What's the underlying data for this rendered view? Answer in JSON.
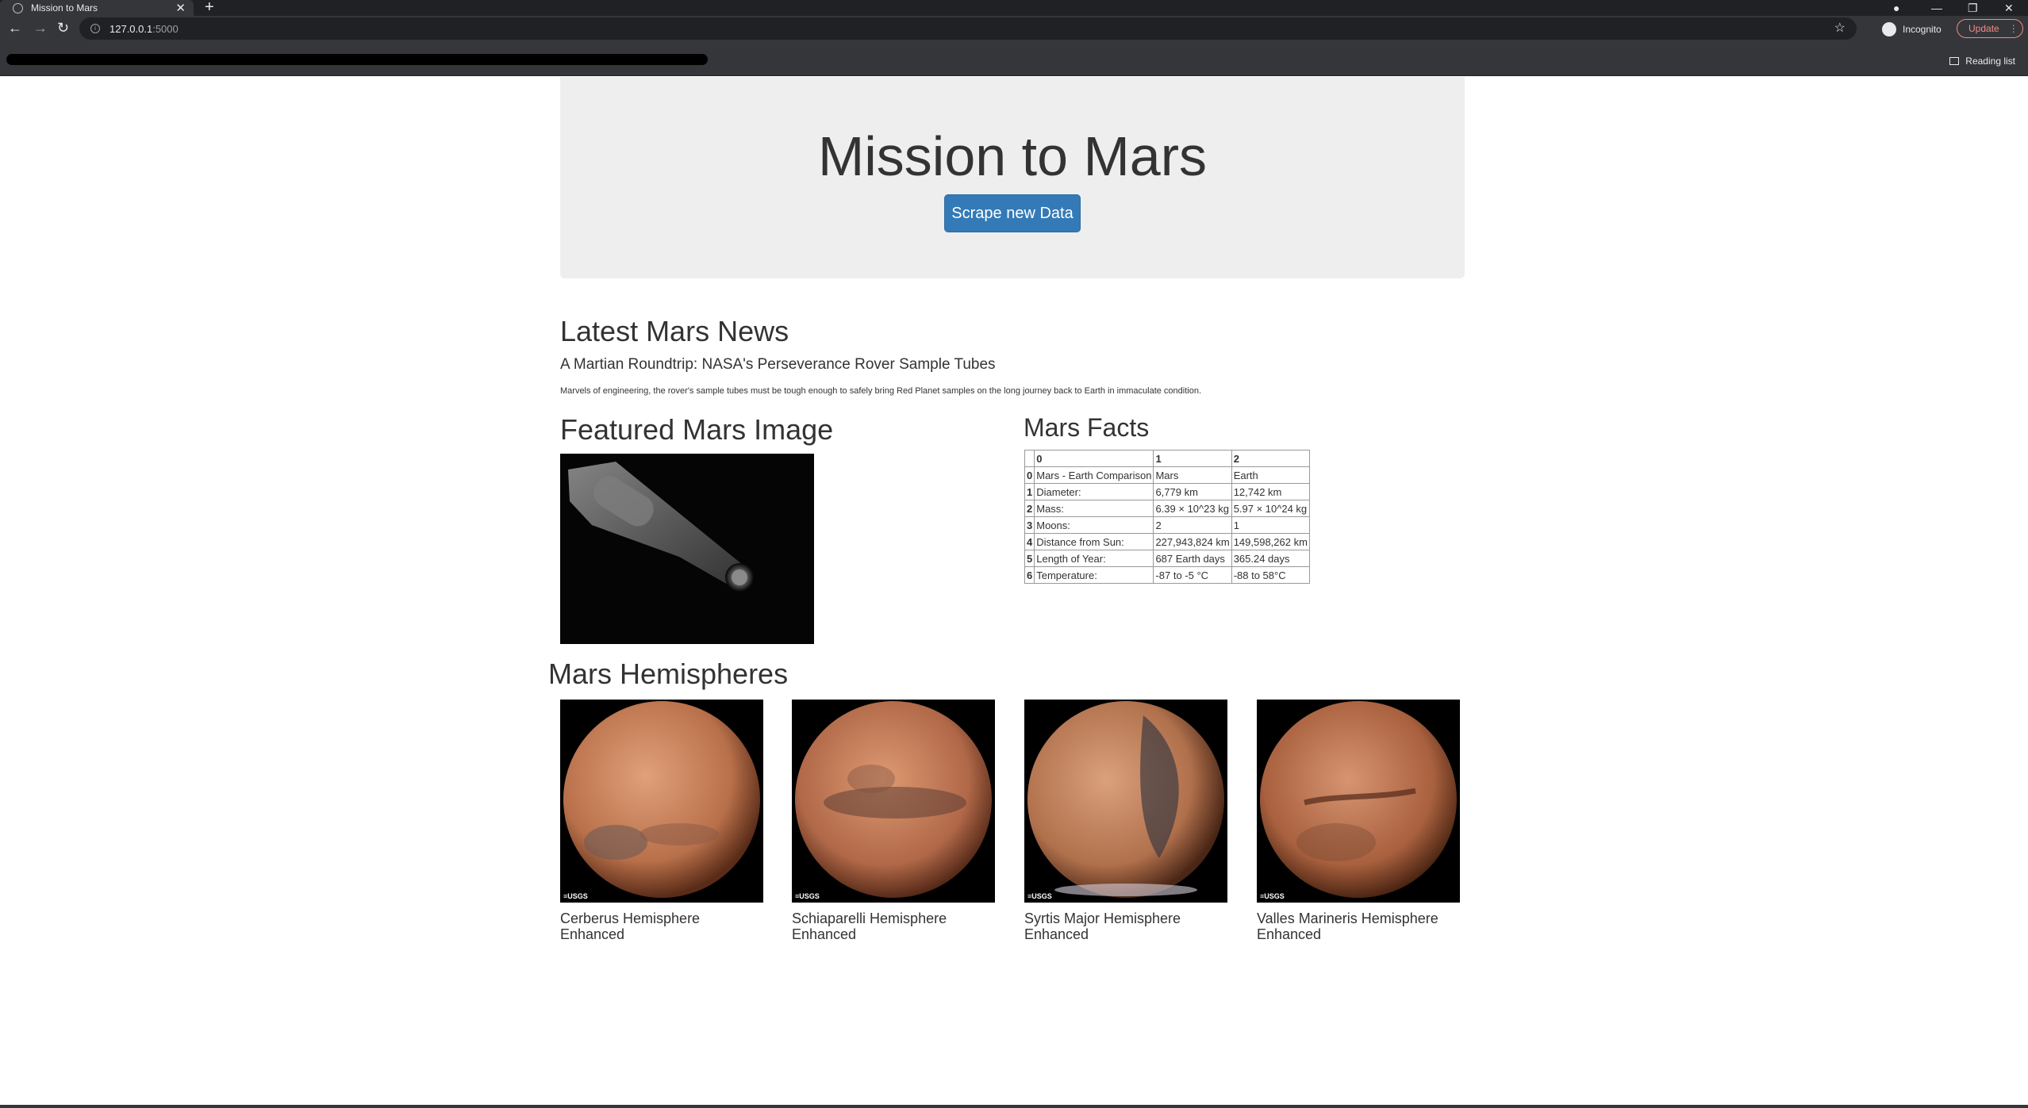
{
  "browser": {
    "tab_title": "Mission to Mars",
    "tab_close": "✕",
    "new_tab": "+",
    "url_host": "127.0.0.1",
    "url_port": ":5000",
    "incognito_label": "Incognito",
    "update_label": "Update",
    "reading_list_label": "Reading list",
    "window_controls": [
      "—",
      "❐",
      "✕"
    ]
  },
  "jumbotron": {
    "title": "Mission to Mars",
    "scrape_button": "Scrape new Data"
  },
  "news": {
    "heading": "Latest Mars News",
    "title": "A Martian Roundtrip: NASA's Perseverance Rover Sample Tubes",
    "paragraph": "Marvels of engineering, the rover's sample tubes must be tough enough to safely bring Red Planet samples on the long journey back to Earth in immaculate condition."
  },
  "featured": {
    "heading": "Featured Mars Image"
  },
  "facts": {
    "heading": "Mars Facts",
    "columns": [
      "",
      "0",
      "1",
      "2"
    ],
    "rows": [
      [
        "0",
        "Mars - Earth Comparison",
        "Mars",
        "Earth"
      ],
      [
        "1",
        "Diameter:",
        "6,779 km",
        "12,742 km"
      ],
      [
        "2",
        "Mass:",
        "6.39 × 10^23 kg",
        "5.97 × 10^24 kg"
      ],
      [
        "3",
        "Moons:",
        "2",
        "1"
      ],
      [
        "4",
        "Distance from Sun:",
        "227,943,824 km",
        "149,598,262 km"
      ],
      [
        "5",
        "Length of Year:",
        "687 Earth days",
        "365.24 days"
      ],
      [
        "6",
        "Temperature:",
        "-87 to -5 °C",
        "-88 to 58°C"
      ]
    ]
  },
  "hemispheres": {
    "heading": "Mars Hemispheres",
    "items": [
      {
        "title": "Cerberus Hemisphere Enhanced",
        "logo": "≡USGS"
      },
      {
        "title": "Schiaparelli Hemisphere Enhanced",
        "logo": "≡USGS"
      },
      {
        "title": "Syrtis Major Hemisphere Enhanced",
        "logo": "≡USGS"
      },
      {
        "title": "Valles Marineris Hemisphere Enhanced",
        "logo": "≡USGS"
      }
    ]
  },
  "colors": {
    "chrome_dark": "#202124",
    "chrome": "#35363a",
    "jumbotron_bg": "#eeeeee",
    "button_primary": "#337ab7",
    "update_accent": "#f28b82"
  }
}
